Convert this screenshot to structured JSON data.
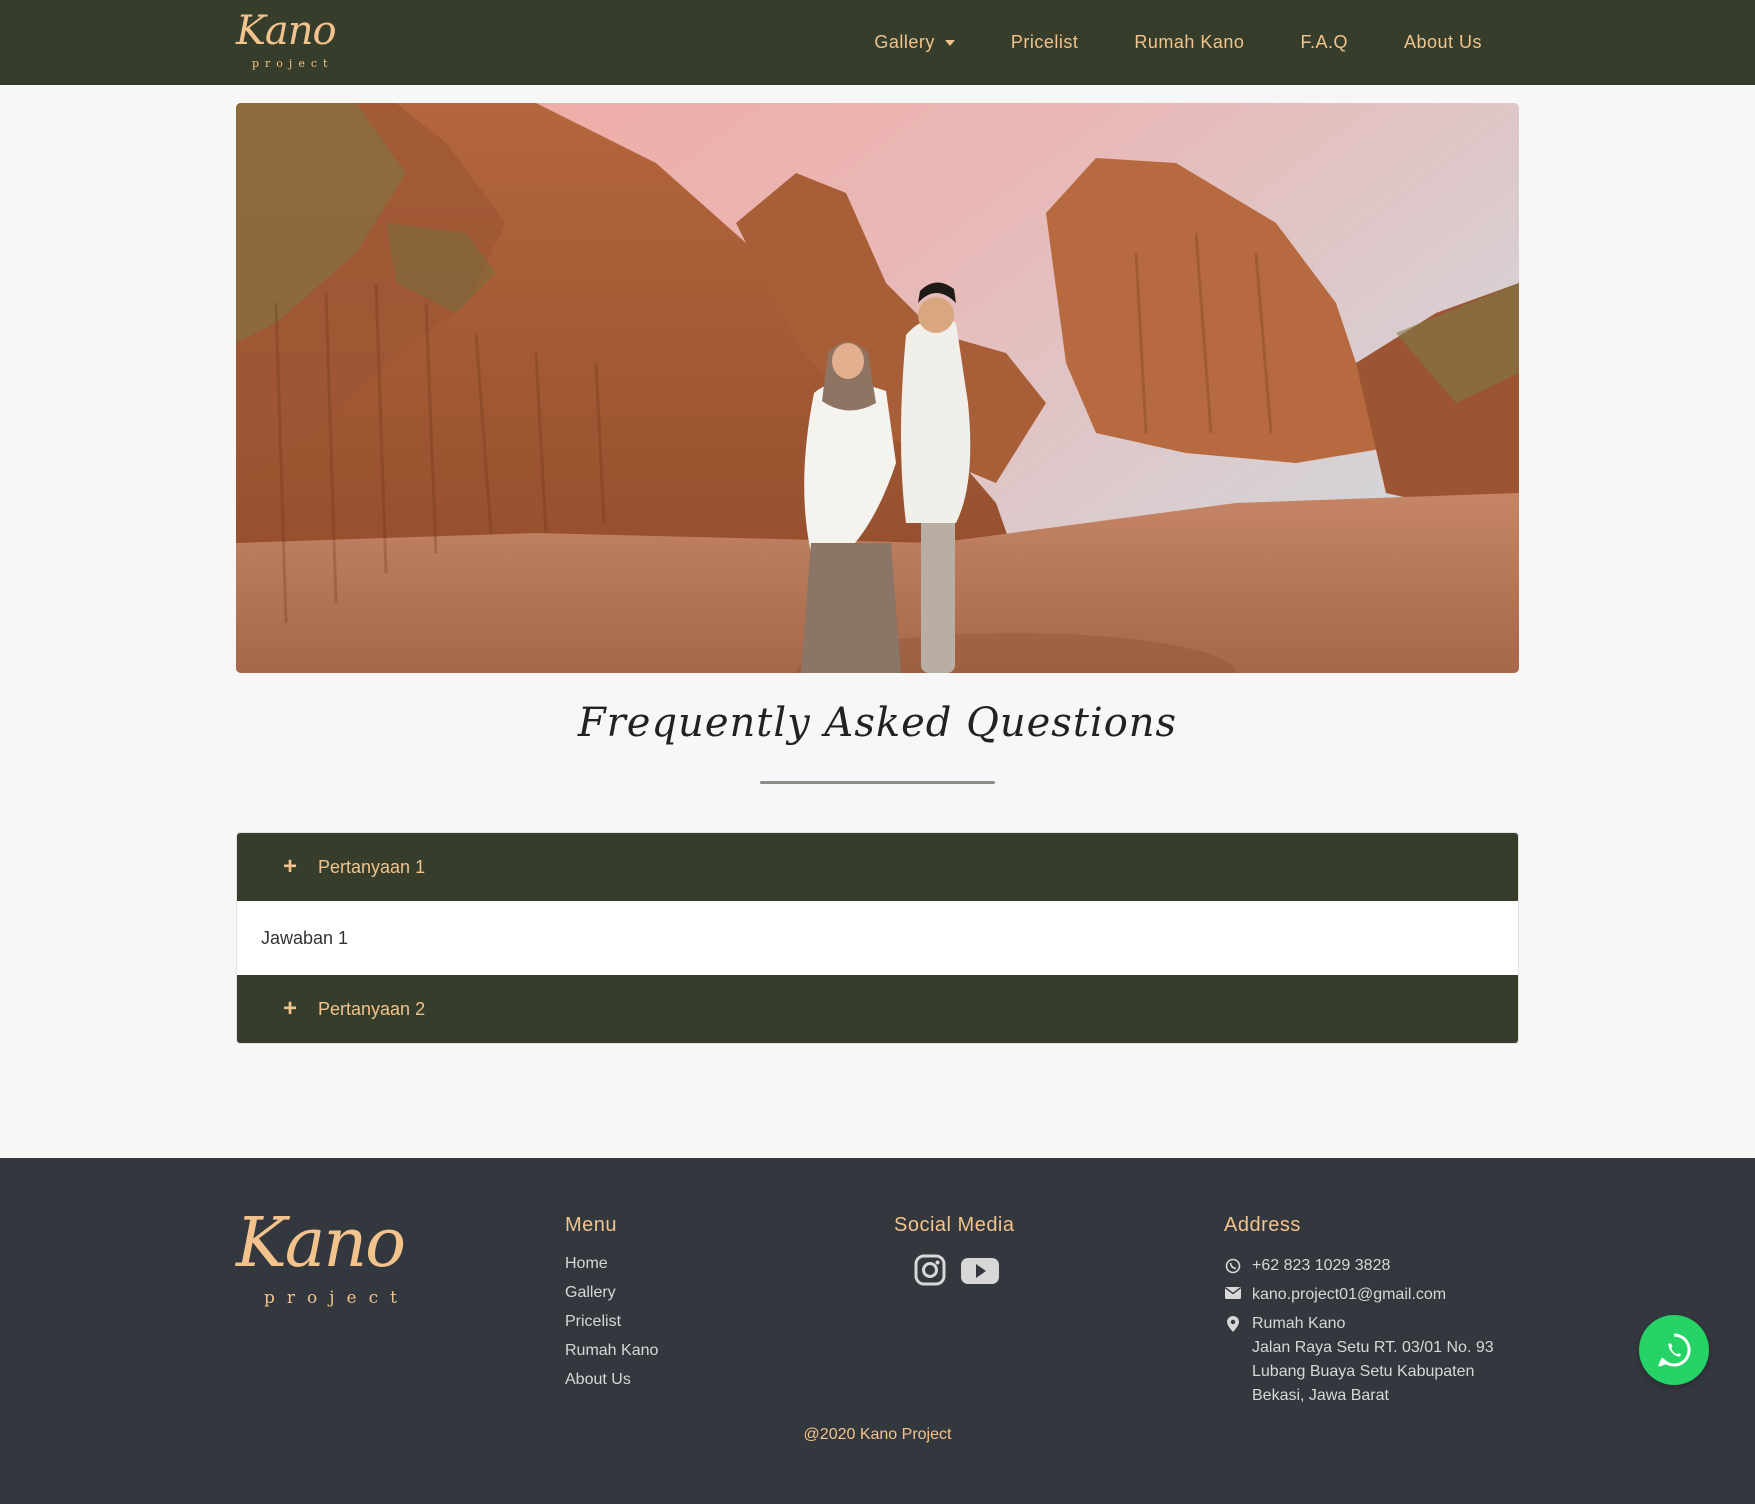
{
  "navbar": {
    "brand_script": "Kano",
    "brand_sub": "project",
    "items": [
      "Gallery",
      "Pricelist",
      "Rumah Kano",
      "F.A.Q",
      "About Us"
    ]
  },
  "hero": {
    "image": "couple-in-canyon-photo"
  },
  "faq": {
    "title": "Frequently Asked Questions",
    "items": [
      {
        "question": "Pertanyaan 1",
        "answer": "Jawaban 1",
        "expanded": true
      },
      {
        "question": "Pertanyaan 2",
        "expanded": false
      }
    ]
  },
  "footer": {
    "logo_script": "Kano",
    "logo_sub": "project",
    "menu_title": "Menu",
    "menu": [
      "Home",
      "Gallery",
      "Pricelist",
      "Rumah Kano",
      "About Us"
    ],
    "social_title": "Social Media",
    "social": [
      "instagram-icon",
      "youtube-icon"
    ],
    "address_title": "Address",
    "phone": "+62 823 1029 3828",
    "email": "kano.project01@gmail.com",
    "address_lines": [
      "Rumah Kano",
      "Jalan Raya Setu RT. 03/01 No. 93",
      "Lubang Buaya Setu Kabupaten",
      "Bekasi, Jawa Barat"
    ],
    "copyright": "@2020 Kano Project"
  },
  "colors": {
    "nav_bg": "#363d2a",
    "accent": "#f2c38c",
    "footer_bg": "#33373e",
    "whatsapp": "#25d366"
  }
}
